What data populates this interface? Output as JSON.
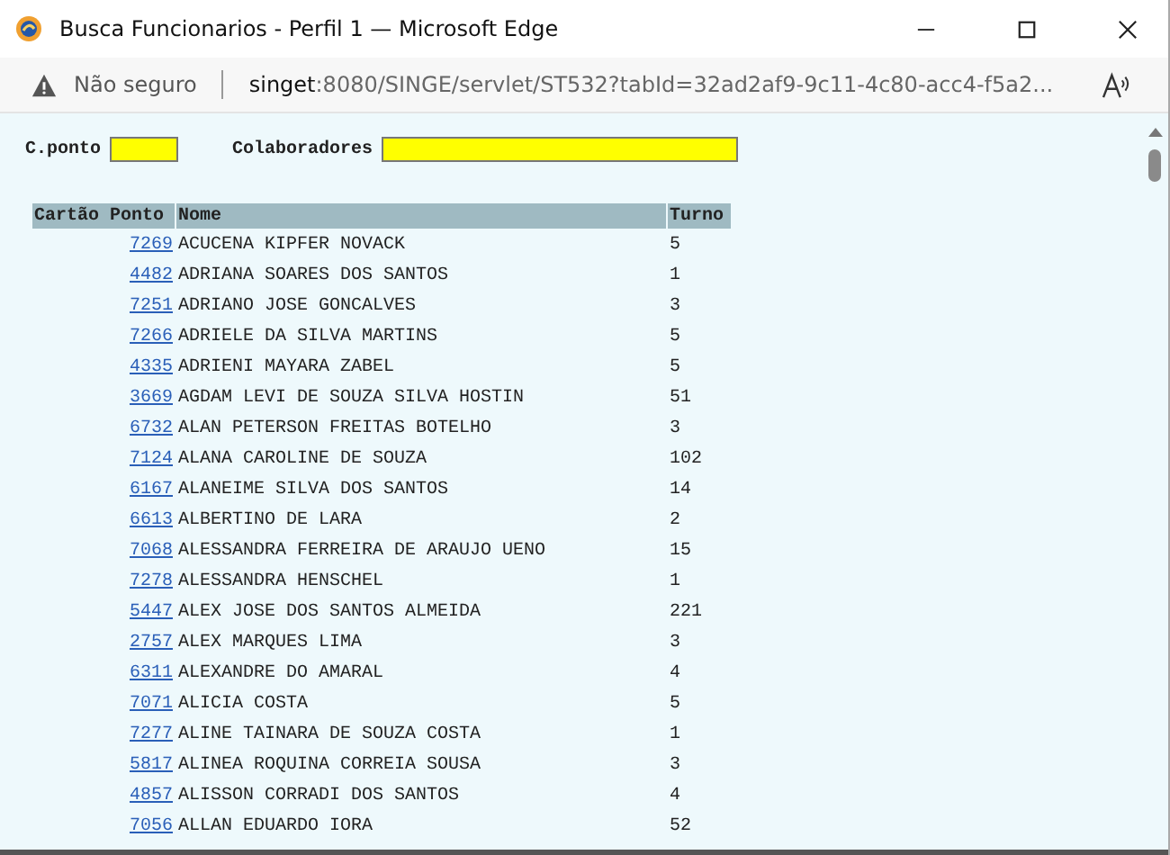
{
  "window": {
    "title": "Busca Funcionarios - Perfil 1 — Microsoft Edge"
  },
  "address_bar": {
    "security": "Não seguro",
    "host": "singet",
    "url_rest": ":8080/SINGE/servlet/ST532?tabId=32ad2af9-9c11-4c80-acc4-f5a2..."
  },
  "filters": [
    {
      "label": "C.ponto"
    },
    {
      "label": "Colaboradores"
    }
  ],
  "table": {
    "columns": [
      "Cartão Ponto",
      "Nome",
      "Turno"
    ],
    "rows": [
      {
        "card": "7269",
        "name": "ACUCENA KIPFER NOVACK",
        "shift": "5"
      },
      {
        "card": "4482",
        "name": "ADRIANA SOARES DOS SANTOS",
        "shift": "1"
      },
      {
        "card": "7251",
        "name": "ADRIANO JOSE GONCALVES",
        "shift": "3"
      },
      {
        "card": "7266",
        "name": "ADRIELE DA SILVA MARTINS",
        "shift": "5"
      },
      {
        "card": "4335",
        "name": "ADRIENI MAYARA ZABEL",
        "shift": "5"
      },
      {
        "card": "3669",
        "name": "AGDAM LEVI DE SOUZA SILVA HOSTIN",
        "shift": "51"
      },
      {
        "card": "6732",
        "name": "ALAN PETERSON FREITAS BOTELHO",
        "shift": "3"
      },
      {
        "card": "7124",
        "name": "ALANA CAROLINE DE SOUZA",
        "shift": "102"
      },
      {
        "card": "6167",
        "name": "ALANEIME SILVA DOS SANTOS",
        "shift": "14"
      },
      {
        "card": "6613",
        "name": "ALBERTINO DE LARA",
        "shift": "2"
      },
      {
        "card": "7068",
        "name": "ALESSANDRA FERREIRA DE ARAUJO UENO",
        "shift": "15"
      },
      {
        "card": "7278",
        "name": "ALESSANDRA HENSCHEL",
        "shift": "1"
      },
      {
        "card": "5447",
        "name": "ALEX JOSE DOS SANTOS ALMEIDA",
        "shift": "221"
      },
      {
        "card": "2757",
        "name": "ALEX MARQUES LIMA",
        "shift": "3"
      },
      {
        "card": "6311",
        "name": "ALEXANDRE DO AMARAL",
        "shift": "4"
      },
      {
        "card": "7071",
        "name": "ALICIA COSTA",
        "shift": "5"
      },
      {
        "card": "7277",
        "name": "ALINE TAINARA DE SOUZA COSTA",
        "shift": "1"
      },
      {
        "card": "5817",
        "name": "ALINEA ROQUINA CORREIA SOUSA",
        "shift": "3"
      },
      {
        "card": "4857",
        "name": "ALISSON CORRADI DOS SANTOS",
        "shift": "4"
      },
      {
        "card": "7056",
        "name": "ALLAN EDUARDO IORA",
        "shift": "52"
      }
    ]
  }
}
